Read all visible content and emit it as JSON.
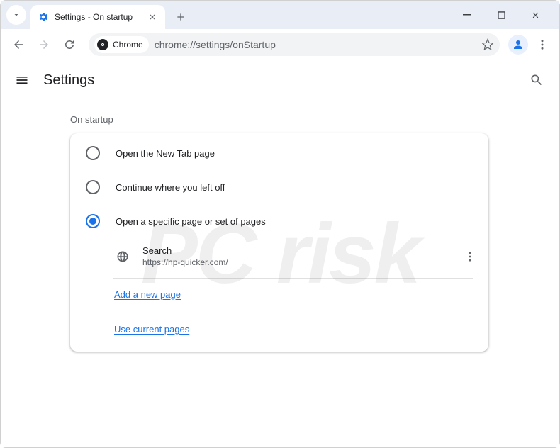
{
  "tab": {
    "title": "Settings - On startup"
  },
  "toolbar": {
    "chip_label": "Chrome",
    "url": "chrome://settings/onStartup"
  },
  "appbar": {
    "title": "Settings"
  },
  "section": {
    "title": "On startup"
  },
  "options": [
    {
      "label": "Open the New Tab page",
      "selected": false
    },
    {
      "label": "Continue where you left off",
      "selected": false
    },
    {
      "label": "Open a specific page or set of pages",
      "selected": true
    }
  ],
  "startup_pages": [
    {
      "name": "Search",
      "url": "https://hp-quicker.com/"
    }
  ],
  "links": {
    "add_page": "Add a new page",
    "use_current": "Use current pages"
  }
}
